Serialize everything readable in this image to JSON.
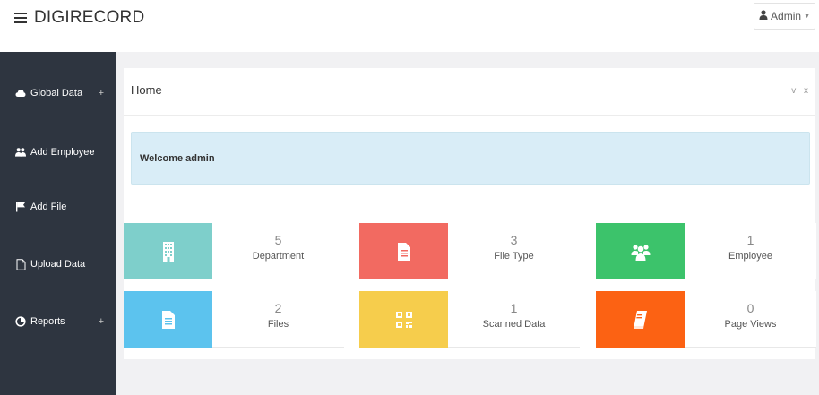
{
  "header": {
    "brand": "DIGIRECORD",
    "user_label": "Admin",
    "menu_icon": "hamburger-icon",
    "user_icon": "user-icon"
  },
  "sidebar": {
    "items": [
      {
        "label": "Global Data",
        "icon": "cloud-icon",
        "expandable": true,
        "plus": "+"
      },
      {
        "label": "Add Employee",
        "icon": "user-plus-icon",
        "expandable": false
      },
      {
        "label": "Add File",
        "icon": "flag-icon",
        "expandable": false
      },
      {
        "label": "Upload Data",
        "icon": "file-icon",
        "expandable": false
      },
      {
        "label": "Reports",
        "icon": "reports-icon",
        "expandable": true,
        "plus": "+"
      }
    ]
  },
  "panel": {
    "title": "Home",
    "collapse_glyph": "v",
    "close_glyph": "x",
    "welcome": "Welcome admin"
  },
  "stats": [
    {
      "count": "5",
      "label": "Department",
      "color": "#7ecfcb",
      "icon": "building-icon"
    },
    {
      "count": "3",
      "label": "File Type",
      "color": "#f26a61",
      "icon": "document-icon"
    },
    {
      "count": "1",
      "label": "Employee",
      "color": "#3cc36b",
      "icon": "users-icon"
    },
    {
      "count": "2",
      "label": "Files",
      "color": "#5cc3ee",
      "icon": "document-icon"
    },
    {
      "count": "1",
      "label": "Scanned Data",
      "color": "#f6cd4c",
      "icon": "qrcode-icon"
    },
    {
      "count": "0",
      "label": "Page Views",
      "color": "#fc6213",
      "icon": "book-icon"
    }
  ],
  "colors": {
    "sidebar_bg": "#2e3540",
    "content_bg": "#f1f1f3",
    "alert_bg": "#d9edf7"
  }
}
